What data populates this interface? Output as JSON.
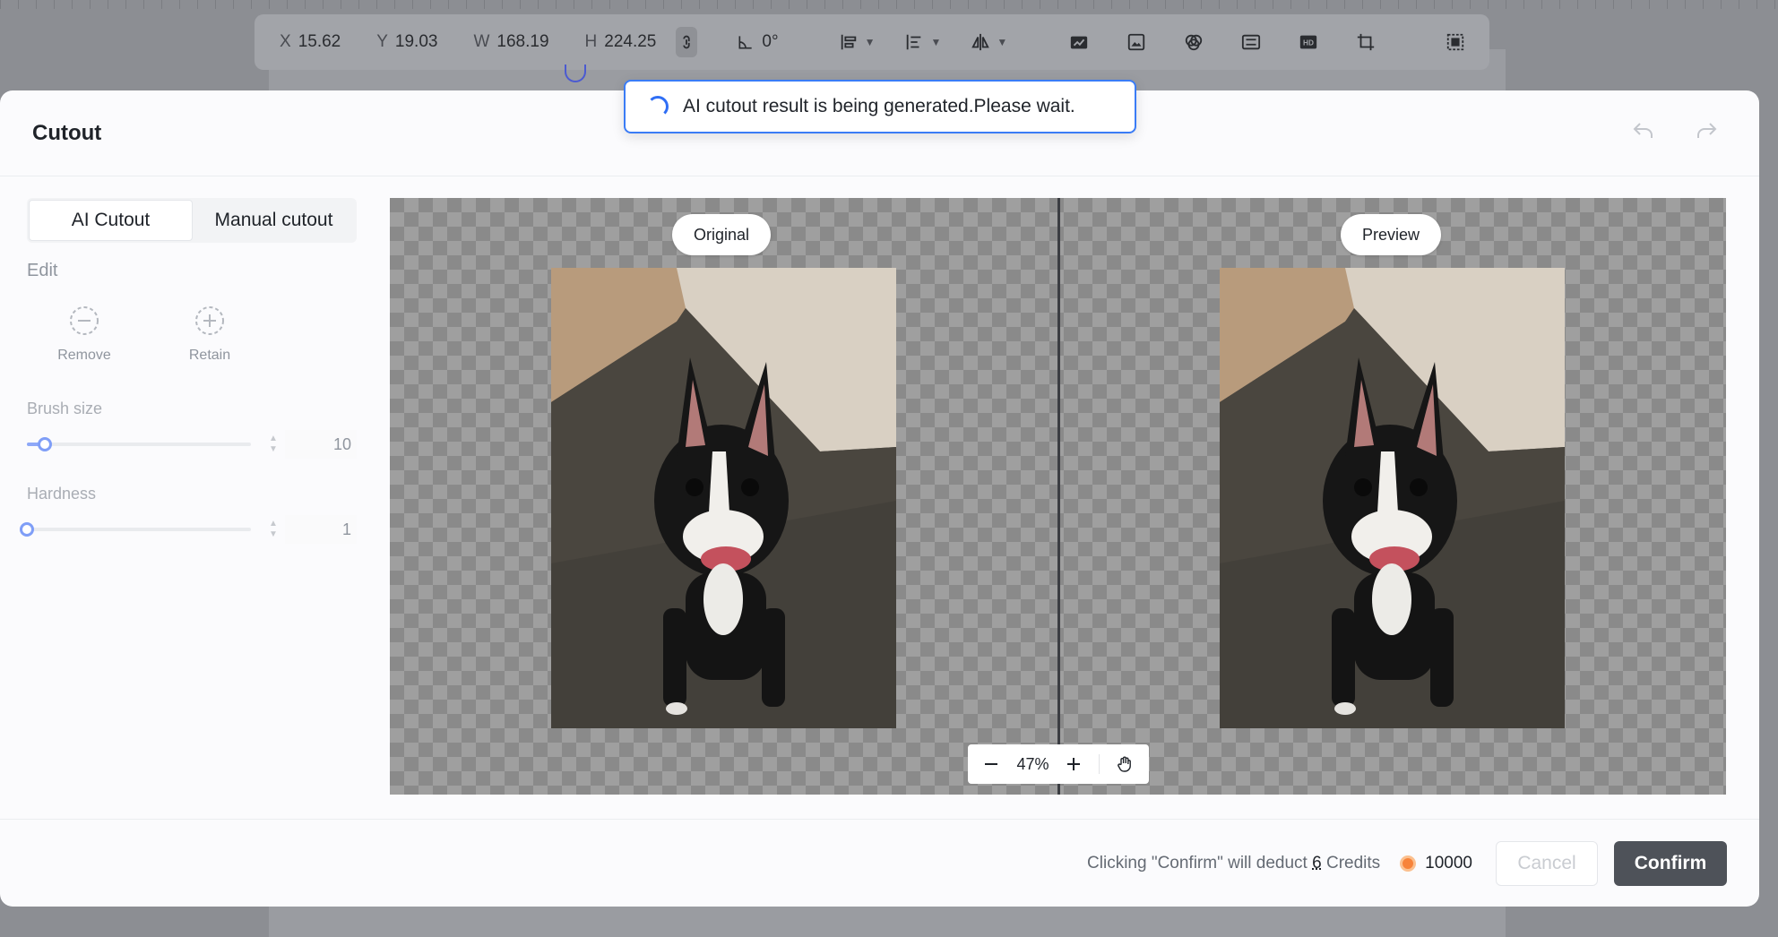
{
  "toolbar": {
    "x_label": "X",
    "x_value": "15.62",
    "y_label": "Y",
    "y_value": "19.03",
    "w_label": "W",
    "w_value": "168.19",
    "h_label": "H",
    "h_value": "224.25",
    "rotation": "0°"
  },
  "toast": {
    "message": "AI cutout result is being generated.Please wait."
  },
  "modal": {
    "title": "Cutout"
  },
  "tabs": [
    {
      "label": "AI Cutout"
    },
    {
      "label": "Manual cutout"
    }
  ],
  "edit": {
    "label": "Edit",
    "tools": [
      {
        "label": "Remove",
        "icon": "minus-circle-icon"
      },
      {
        "label": "Retain",
        "icon": "plus-circle-icon"
      }
    ]
  },
  "brush": {
    "label": "Brush size",
    "value": "10",
    "level": 0.08
  },
  "hardness": {
    "label": "Hardness",
    "value": "1",
    "level": 0.0
  },
  "canvas": {
    "original_label": "Original",
    "preview_label": "Preview",
    "zoom": "47%"
  },
  "footer": {
    "deduct_prefix": "Clicking \"Confirm\" will deduct",
    "deduct_amount": "6",
    "deduct_suffix": "Credits",
    "balance": "10000",
    "cancel_label": "Cancel",
    "confirm_label": "Confirm"
  },
  "colors": {
    "accent": "#3a7cf6",
    "confirm_bg": "#4e5259",
    "coin": "#f7833a"
  }
}
